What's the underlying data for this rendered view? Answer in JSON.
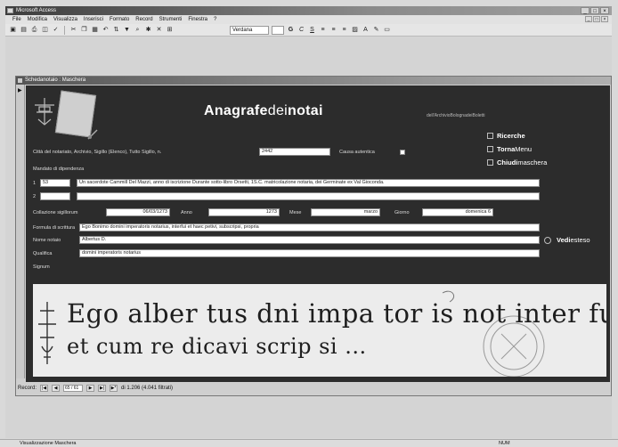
{
  "app": {
    "title": "Microsoft Access"
  },
  "menu": {
    "items": [
      "File",
      "Modifica",
      "Visualizza",
      "Inserisci",
      "Formato",
      "Record",
      "Strumenti",
      "Finestra",
      "?"
    ]
  },
  "toolbar": {
    "font_name": "Verdana"
  },
  "form": {
    "window_title": "Schedanotaio : Maschera",
    "header_title_bold": "Anagrafe",
    "header_title_thin": "dei",
    "header_title_bold2": "notai",
    "header_subtitle": "dell'ArchivioBolognadeiBoletti",
    "options": [
      {
        "bold": "Ricerche",
        "thin": "Ricerche"
      },
      {
        "bold": "Torna",
        "thin": "Menu"
      },
      {
        "bold": "Chiudi",
        "thin": "maschera"
      }
    ],
    "fields": {
      "intro_label": "Città del notariato, Archivio, Sigillo (Elenco), Tutto Sigillo, n.",
      "intro_value": "2442",
      "causa_label": "Causa autentica",
      "mandato_label": "Mandato di dipendenza",
      "row1_num": "1",
      "row1_code": "53",
      "row1_text": "Un sacerdote Cammill Del Mazzi, anno di iscrizione Durante sotto-libro Orsetti, 1S.C. matricolazione notaria, dei Germinate ex Val Gioconda.",
      "row2_num": "2",
      "row2_code": "",
      "row2_text": "",
      "date_label": "Collazione sigillorum",
      "date_value": "06/03/1273",
      "anno_label": "Anno",
      "anno_value": "1273",
      "mese_label": "Mese",
      "mese_value": "marzo",
      "giorno_label": "Giorno",
      "giorno_value": "domenica 6",
      "formula_label": "Formula di scrittura",
      "formula_value": "Ego Bonimo domini imperatoris notarius, interfui et haec petivi, subscripsi, propria",
      "nome_label": "Nome notaio",
      "nome_value": "Albertus D.",
      "qualifica_label": "Qualifica",
      "qualifica_value": "domini imperatoris notarius",
      "signum_label": "Signum"
    },
    "vedi": {
      "bold": "Vedi",
      "thin": "esteso"
    },
    "manuscript_line1": "Ego alber tus dni impa tor is not inter fui",
    "manuscript_line2": "et cum re dicavi scrip si ..."
  },
  "navigation": {
    "record_label": "Record:",
    "current_record": "65 / 61",
    "total_label": "di 1.206 (4.041 filtrati)"
  },
  "status": {
    "left": "Visualizzazione Maschera",
    "right": "NUM"
  },
  "colors": {
    "form_background": "#2c2c2c",
    "chrome_background": "#d9d9d9",
    "title_bar": "#3d3d3d"
  }
}
